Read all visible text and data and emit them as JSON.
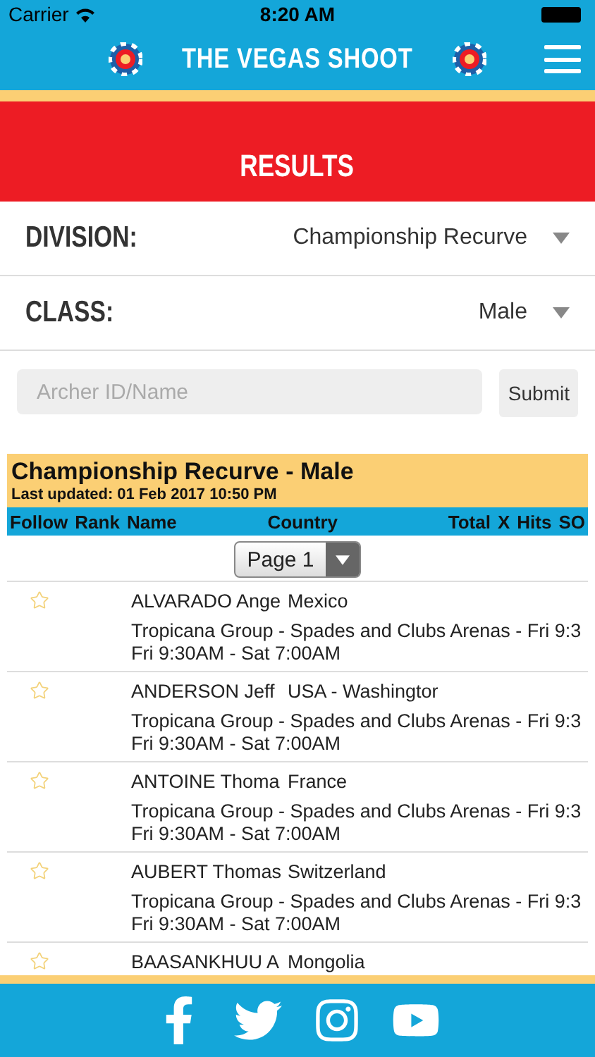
{
  "status_bar": {
    "carrier": "Carrier",
    "time": "8:20 AM"
  },
  "app_bar": {
    "title": "THE VEGAS SHOOT"
  },
  "banner": {
    "title": "RESULTS"
  },
  "filters": [
    {
      "label": "DIVISION:",
      "value": "Championship Recurve"
    },
    {
      "label": "CLASS:",
      "value": "Male"
    }
  ],
  "search": {
    "placeholder": "Archer ID/Name",
    "button": "Submit"
  },
  "results": {
    "title": "Championship Recurve - Male",
    "updated": "Last updated: 01 Feb 2017 10:50 PM",
    "columns": [
      "Follow",
      "Rank",
      "Name",
      "Country",
      "Total",
      "X",
      "Hits",
      "SO"
    ],
    "page": "Page 1",
    "rows": [
      {
        "followed": false,
        "name": "ALVARADO Ange",
        "country": "Mexico",
        "detail": "Tropicana Group - Spades and Clubs Arenas - Fri 9:3",
        "time": "Fri 9:30AM - Sat 7:00AM"
      },
      {
        "followed": false,
        "name": "ANDERSON Jeff",
        "country": "USA - Washingtor",
        "detail": "Tropicana Group - Spades and Clubs Arenas - Fri 9:3",
        "time": "Fri 9:30AM - Sat 7:00AM"
      },
      {
        "followed": false,
        "name": "ANTOINE Thoma",
        "country": "France",
        "detail": "Tropicana Group - Spades and Clubs Arenas - Fri 9:3",
        "time": "Fri 9:30AM - Sat 7:00AM"
      },
      {
        "followed": false,
        "name": "AUBERT Thomas",
        "country": "Switzerland",
        "detail": "Tropicana Group - Spades and Clubs Arenas - Fri 9:3",
        "time": "Fri 9:30AM - Sat 7:00AM"
      },
      {
        "followed": false,
        "name": "BAASANKHUU A",
        "country": "Mongolia"
      }
    ]
  },
  "footer": {
    "links": [
      {
        "kind": "facebook"
      },
      {
        "kind": "twitter"
      },
      {
        "kind": "instagram"
      },
      {
        "kind": "youtube"
      }
    ]
  }
}
